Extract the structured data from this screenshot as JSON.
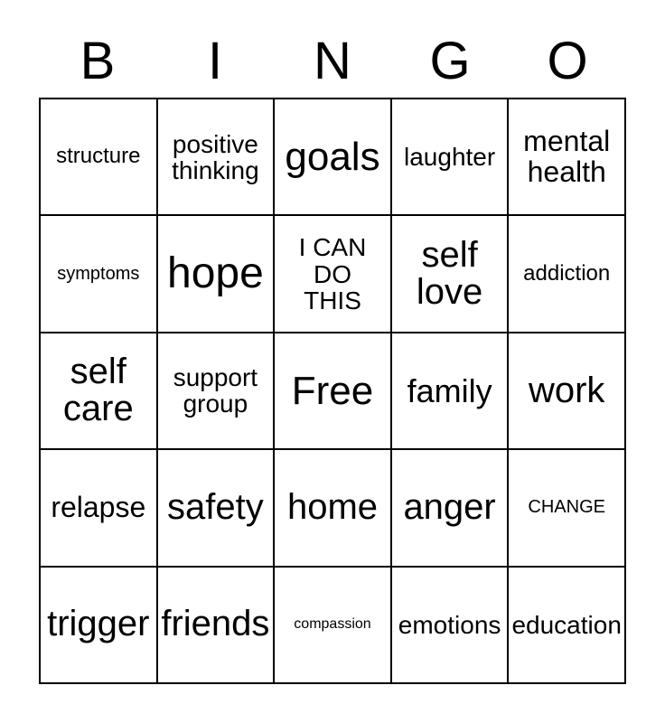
{
  "card": {
    "title": "BINGO",
    "header_letters": [
      "B",
      "I",
      "N",
      "G",
      "O"
    ],
    "grid_size": "5x5",
    "free_space_label": "Free",
    "free_space_position": "center",
    "text_color": "#000000",
    "background_color": "#ffffff",
    "border_color": "#000000"
  },
  "cells": [
    {
      "text": "structure",
      "size": "fs-md",
      "column": "B",
      "row": 1
    },
    {
      "text": "positive\nthinking",
      "size": "fs-lg",
      "column": "I",
      "row": 1
    },
    {
      "text": "goals",
      "size": "fs-4xl",
      "column": "N",
      "row": 1
    },
    {
      "text": "laughter",
      "size": "fs-lg",
      "column": "G",
      "row": 1
    },
    {
      "text": "mental\nhealth",
      "size": "fs-xl",
      "column": "O",
      "row": 1
    },
    {
      "text": "symptoms",
      "size": "fs-sm",
      "column": "B",
      "row": 2
    },
    {
      "text": "hope",
      "size": "fs-5xl",
      "column": "I",
      "row": 2
    },
    {
      "text": "I CAN\nDO\nTHIS",
      "size": "fs-lg",
      "column": "N",
      "row": 2
    },
    {
      "text": "self\nlove",
      "size": "fs-3xl",
      "column": "G",
      "row": 2
    },
    {
      "text": "addiction",
      "size": "fs-md",
      "column": "O",
      "row": 2
    },
    {
      "text": "self\ncare",
      "size": "fs-3xl",
      "column": "B",
      "row": 3
    },
    {
      "text": "support\ngroup",
      "size": "fs-lg",
      "column": "I",
      "row": 3
    },
    {
      "text": "Free",
      "size": "fs-4xl",
      "column": "N",
      "row": 3
    },
    {
      "text": "family",
      "size": "fs-2xl",
      "column": "G",
      "row": 3
    },
    {
      "text": "work",
      "size": "fs-3xl",
      "column": "O",
      "row": 3
    },
    {
      "text": "relapse",
      "size": "fs-xl",
      "column": "B",
      "row": 4
    },
    {
      "text": "safety",
      "size": "fs-3xl",
      "column": "I",
      "row": 4
    },
    {
      "text": "home",
      "size": "fs-3xl",
      "column": "N",
      "row": 4
    },
    {
      "text": "anger",
      "size": "fs-3xl",
      "column": "G",
      "row": 4
    },
    {
      "text": "CHANGE",
      "size": "fs-sm",
      "column": "O",
      "row": 4
    },
    {
      "text": "trigger",
      "size": "fs-3xl",
      "column": "B",
      "row": 5
    },
    {
      "text": "friends",
      "size": "fs-3xl",
      "column": "I",
      "row": 5
    },
    {
      "text": "compassion",
      "size": "fs-xs",
      "column": "N",
      "row": 5
    },
    {
      "text": "emotions",
      "size": "fs-lg",
      "column": "G",
      "row": 5
    },
    {
      "text": "education",
      "size": "fs-lg",
      "column": "O",
      "row": 5
    }
  ]
}
